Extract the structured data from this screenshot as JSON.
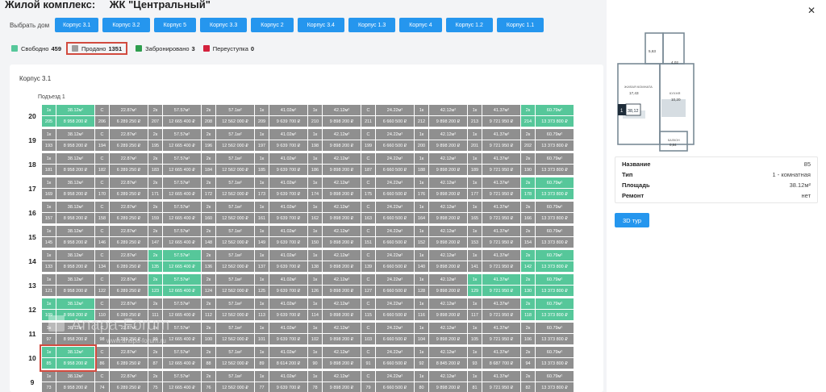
{
  "header": {
    "complex_label": "Жилой комплекс:",
    "complex_name": "ЖК \"Центральный\""
  },
  "houses": {
    "label": "Выбрать дом",
    "items": [
      "Корпус 3.1",
      "Корпус 3.2",
      "Корпус 5",
      "Корпус 3.3",
      "Корпус 2",
      "Корпус 3.4",
      "Корпус 1.3",
      "Корпус 4",
      "Корпус 1.2",
      "Корпус 1.1"
    ]
  },
  "legend": [
    {
      "label": "Свободно",
      "count": "459",
      "color": "#56c79a"
    },
    {
      "label": "Продано",
      "count": "1351",
      "color": "#9e9e9e"
    },
    {
      "label": "Забронировано",
      "count": "3",
      "color": "#2e9e4e"
    },
    {
      "label": "Переуступка",
      "count": "0",
      "color": "#d4213d"
    }
  ],
  "grid": {
    "korpus_title": "Корпус 3.1",
    "podezd": "Подъезд 1",
    "columns": [
      {
        "type": "1к",
        "area": "38.12м²",
        "price": "8 958 200 ₽"
      },
      {
        "type": "С",
        "area": "22.87м²",
        "price": "6 289 250 ₽"
      },
      {
        "type": "2к",
        "area": "57.57м²",
        "price": "12 665 400 ₽"
      },
      {
        "type": "2к",
        "area": "57.1м²",
        "price": "12 562 000 ₽"
      },
      {
        "type": "1к",
        "area": "41.02м²",
        "price": "9 639 700 ₽"
      },
      {
        "type": "1к",
        "area": "42.12м²",
        "price": "9 898 200 ₽"
      },
      {
        "type": "С",
        "area": "24.22м²",
        "price": "6 660 500 ₽"
      },
      {
        "type": "1к",
        "area": "42.12м²",
        "price": "9 898 200 ₽"
      },
      {
        "type": "1к",
        "area": "41.37м²",
        "price": "9 721 950 ₽"
      },
      {
        "type": "2к",
        "area": "60.79м²",
        "price": "13 373 800 ₽"
      }
    ],
    "floors": [
      {
        "floor": "20",
        "numbers": [
          "205",
          "206",
          "207",
          "208",
          "209",
          "210",
          "211",
          "212",
          "213",
          "214"
        ],
        "free": [
          0,
          9
        ]
      },
      {
        "floor": "19",
        "numbers": [
          "193",
          "194",
          "195",
          "196",
          "197",
          "198",
          "199",
          "200",
          "201",
          "202"
        ],
        "free": []
      },
      {
        "floor": "18",
        "numbers": [
          "181",
          "182",
          "183",
          "184",
          "185",
          "186",
          "187",
          "188",
          "189",
          "190"
        ],
        "free": []
      },
      {
        "floor": "17",
        "numbers": [
          "169",
          "170",
          "171",
          "172",
          "173",
          "174",
          "175",
          "176",
          "177",
          "178"
        ],
        "free": [
          9
        ]
      },
      {
        "floor": "16",
        "numbers": [
          "157",
          "158",
          "159",
          "160",
          "161",
          "162",
          "163",
          "164",
          "165",
          "166"
        ],
        "free": []
      },
      {
        "floor": "15",
        "numbers": [
          "145",
          "146",
          "147",
          "148",
          "149",
          "150",
          "151",
          "152",
          "153",
          "154"
        ],
        "free": []
      },
      {
        "floor": "14",
        "numbers": [
          "133",
          "134",
          "135",
          "136",
          "137",
          "138",
          "139",
          "140",
          "141",
          "142"
        ],
        "free": [
          2,
          9
        ]
      },
      {
        "floor": "13",
        "numbers": [
          "121",
          "122",
          "123",
          "124",
          "125",
          "126",
          "127",
          "128",
          "129",
          "130"
        ],
        "free": [
          2,
          8,
          9
        ]
      },
      {
        "floor": "12",
        "numbers": [
          "109",
          "110",
          "111",
          "112",
          "113",
          "114",
          "115",
          "116",
          "117",
          "118"
        ],
        "free": [
          0,
          9
        ]
      },
      {
        "floor": "11",
        "numbers": [
          "97",
          "98",
          "99",
          "100",
          "101",
          "102",
          "103",
          "104",
          "105",
          "106"
        ],
        "free": []
      },
      {
        "floor": "10",
        "numbers": [
          "85",
          "86",
          "87",
          "88",
          "89",
          "90",
          "91",
          "92",
          "93",
          "94"
        ],
        "free": [
          0
        ],
        "price_overrides": {
          "4": "8 614 200 ₽",
          "7": "8 845 200 ₽",
          "8": "8 687 700 ₽"
        }
      },
      {
        "floor": "9",
        "numbers": [
          "73",
          "74",
          "75",
          "76",
          "77",
          "78",
          "79",
          "80",
          "81",
          "82"
        ],
        "free": []
      }
    ]
  },
  "plan": {
    "rooms": [
      {
        "name": "ЖИЛАЯ КОМНАТА",
        "area": "17,43"
      },
      {
        "name": "",
        "area": "5,63"
      },
      {
        "name": "",
        "area": "4,02"
      },
      {
        "name": "КУХНЯ",
        "area": "10,20"
      },
      {
        "name": "БАЛКОН",
        "area": "0,84"
      }
    ],
    "badge_rooms": "1",
    "badge_area": "38,12"
  },
  "details": {
    "rows": [
      {
        "key": "Название",
        "value": "85"
      },
      {
        "key": "Тип",
        "value": "1 - комнатная"
      },
      {
        "key": "Площадь",
        "value": "38.12м²"
      },
      {
        "key": "Ремонт",
        "value": "нет"
      }
    ],
    "tour_button": "3D тур"
  },
  "watermark": {
    "title": "Anapa-Forum",
    "url": "www.anapa-forum.ru"
  },
  "colors": {
    "accent": "#2596ee",
    "free": "#56c79a",
    "sold": "#8f8f8f",
    "highlight": "#d24b3f"
  }
}
